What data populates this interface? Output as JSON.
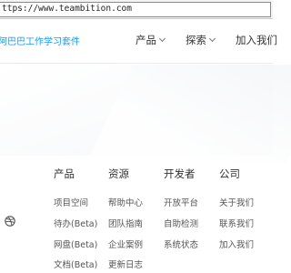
{
  "browser": {
    "url": "ttps://www.teambition.com"
  },
  "header": {
    "brand": "阿巴巴工作学习套件",
    "nav": {
      "products": "产品",
      "explore": "探索",
      "join": "加入我们"
    }
  },
  "footer": {
    "columns": [
      {
        "heading": "产品",
        "links": [
          "项目空间",
          "待办(Beta)",
          "网盘(Beta)",
          "文档(Beta)"
        ]
      },
      {
        "heading": "资源",
        "links": [
          "帮助中心",
          "团队指南",
          "企业案例",
          "更新日志"
        ]
      },
      {
        "heading": "开发者",
        "links": [
          "开放平台",
          "自助检测",
          "系统状态"
        ]
      },
      {
        "heading": "公司",
        "links": [
          "关于我们",
          "联系我们",
          "加入我们"
        ]
      }
    ]
  },
  "icons": {
    "social": "dribbble-icon",
    "dropdown": "chevron-down-icon"
  }
}
